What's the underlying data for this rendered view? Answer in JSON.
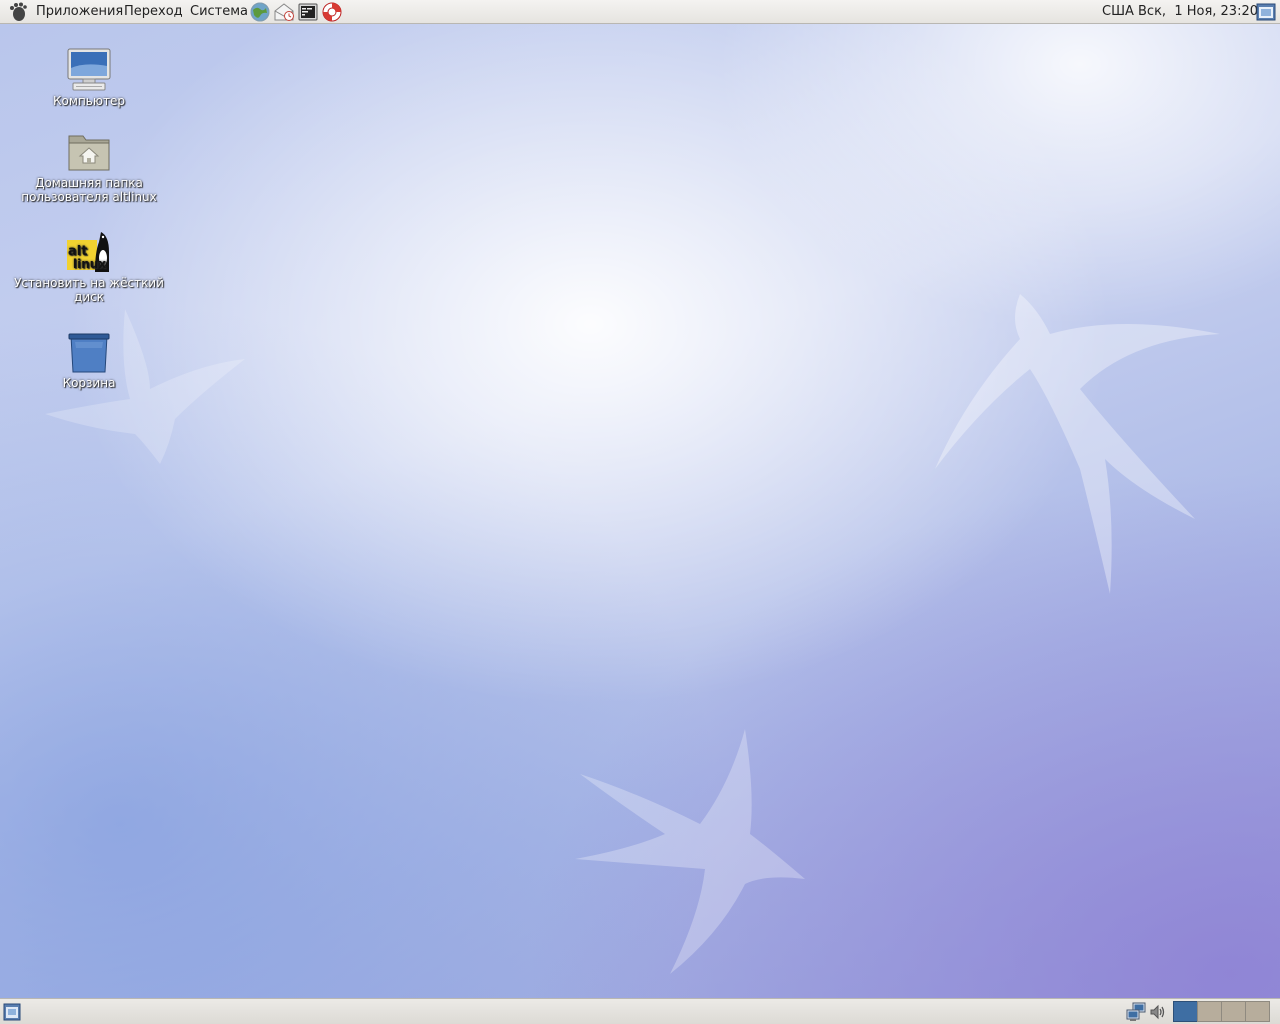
{
  "top_panel": {
    "menus": [
      {
        "label": "Приложения"
      },
      {
        "label": "Переход"
      },
      {
        "label": "Система"
      }
    ],
    "launchers": [
      "web-browser-icon",
      "mail-client-icon",
      "terminal-icon",
      "help-lifebuoy-icon"
    ],
    "keyboard_layout": "США",
    "clock": "Вск,  1 Ноя, 23:20"
  },
  "desktop": {
    "icons": [
      {
        "label": "Компьютер",
        "icon": "computer-icon"
      },
      {
        "label": "Домашняя папка пользователя altlinux",
        "icon": "home-folder-icon"
      },
      {
        "label": "Установить на жёсткий диск",
        "icon": "altlinux-installer-icon",
        "badge_text": [
          "alt",
          "linux"
        ]
      },
      {
        "label": "Корзина",
        "icon": "trash-icon"
      }
    ]
  },
  "bottom_panel": {
    "tray": [
      "network-icon",
      "volume-icon"
    ],
    "workspaces": 4,
    "active_workspace": 1
  },
  "colors": {
    "panel_bg": "#e8e6e2",
    "active_workspace": "#3e6ea3",
    "inactive_workspace": "#b7ad9c"
  }
}
